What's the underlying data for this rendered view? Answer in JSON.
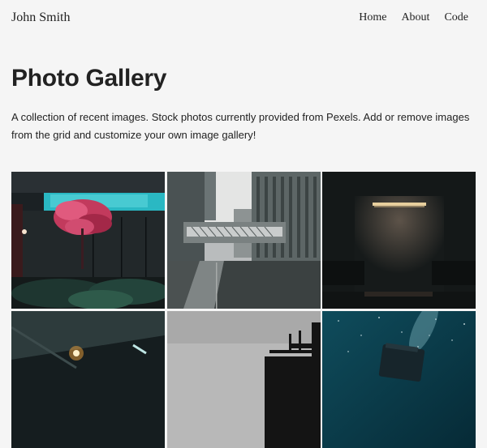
{
  "nav": {
    "brand": "John Smith",
    "links": [
      {
        "label": "Home"
      },
      {
        "label": "About"
      },
      {
        "label": "Code"
      }
    ]
  },
  "main": {
    "title": "Photo Gallery",
    "description": "A collection of recent images. Stock photos currently provided from Pexels. Add or remove images from the grid and customize your own image gallery!"
  },
  "gallery": {
    "images": [
      {
        "name": "neon-storefront-tree"
      },
      {
        "name": "city-skybridge-rain"
      },
      {
        "name": "dark-wall-lamp-benches"
      },
      {
        "name": "dark-ceiling-lights"
      },
      {
        "name": "grey-sky-building-silhouette"
      },
      {
        "name": "starry-sky-teal"
      }
    ]
  }
}
